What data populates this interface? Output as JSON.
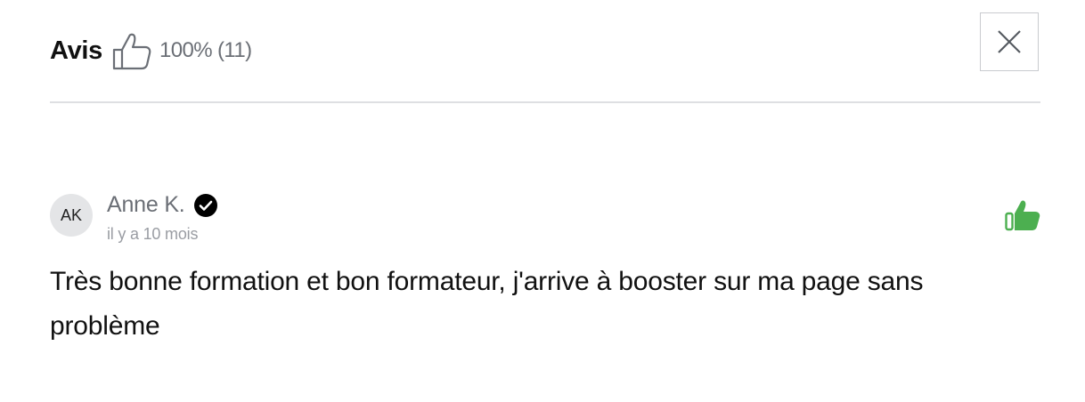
{
  "header": {
    "title": "Avis",
    "rating": "100% (11)",
    "thumb_icon": "thumbs-up-outline-icon",
    "close_icon": "close-icon"
  },
  "review": {
    "initials": "AK",
    "author": "Anne K.",
    "verified_icon": "verified-check-icon",
    "date": "il y a 10 mois",
    "vote_icon": "thumbs-up-filled-icon",
    "vote_color": "#4caf50",
    "text": "Très bonne formation et bon formateur, j'arrive à booster sur ma page sans problème"
  }
}
